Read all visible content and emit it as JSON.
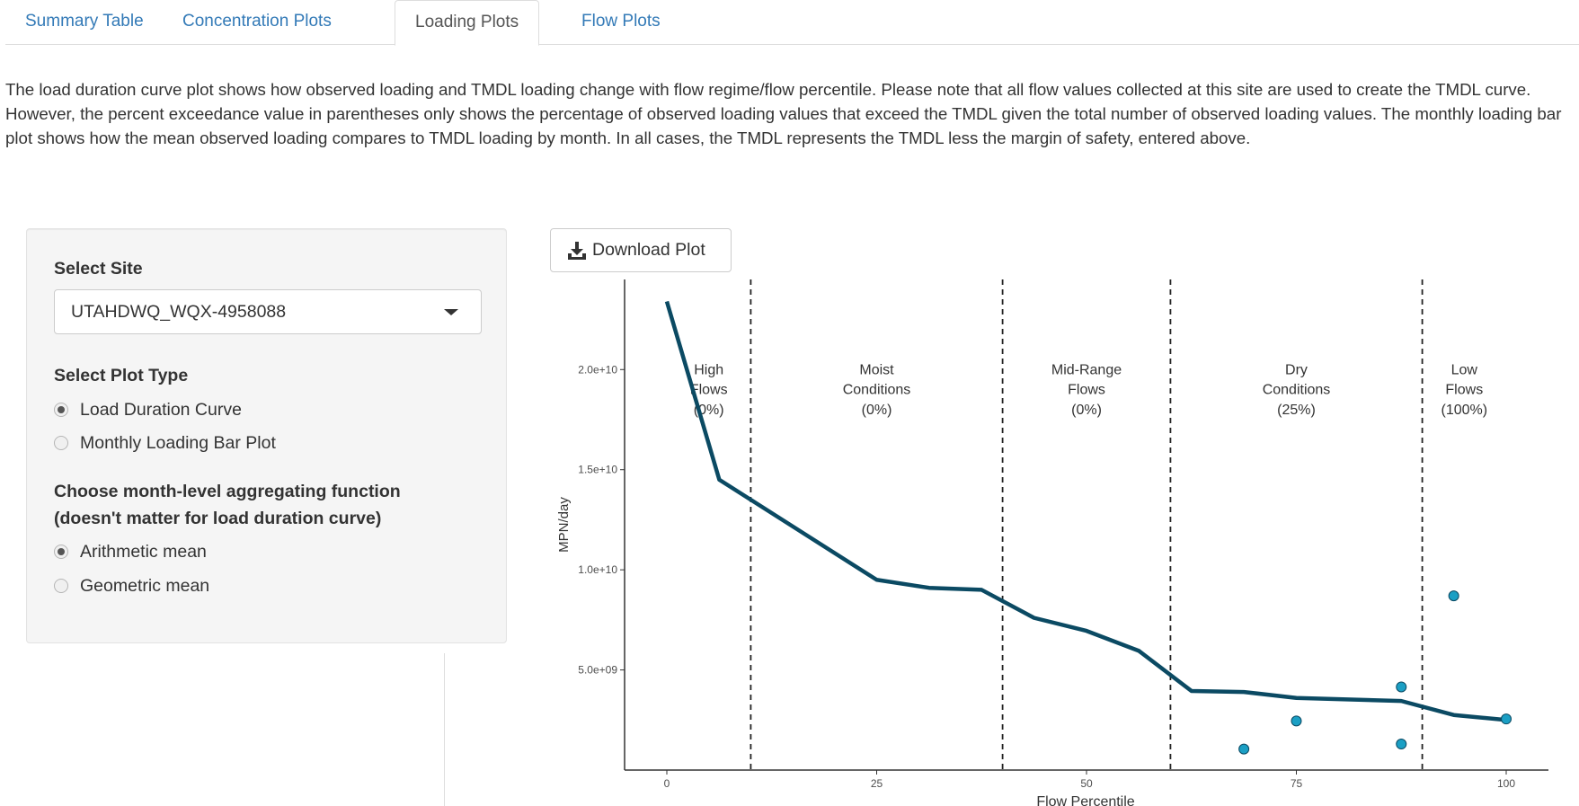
{
  "tabs": [
    {
      "label": "Summary Table",
      "active": false
    },
    {
      "label": "Concentration Plots",
      "active": false
    },
    {
      "label": "Loading Plots",
      "active": true
    },
    {
      "label": "Flow Plots",
      "active": false
    }
  ],
  "description": "The load duration curve plot shows how observed loading and TMDL loading change with flow regime/flow percentile. Please note that all flow values collected at this site are used to create the TMDL curve. However, the percent exceedance value in parentheses only shows the percentage of observed loading values that exceed the TMDL given the total number of observed loading values. The monthly loading bar plot shows how the mean observed loading compares to TMDL loading by month. In all cases, the TMDL represents the TMDL less the margin of safety, entered above.",
  "sidebar": {
    "site_label": "Select Site",
    "site_value": "UTAHDWQ_WQX-4958088",
    "plot_type_label": "Select Plot Type",
    "plot_types": [
      {
        "label": "Load Duration Curve",
        "checked": true
      },
      {
        "label": "Monthly Loading Bar Plot",
        "checked": false
      }
    ],
    "agg_label_line1": "Choose month-level aggregating function",
    "agg_label_line2": "(doesn't matter for load duration curve)",
    "agg_options": [
      {
        "label": "Arithmetic mean",
        "checked": true
      },
      {
        "label": "Geometric mean",
        "checked": false
      }
    ]
  },
  "download_button": {
    "label": "Download Plot",
    "icon": "download-icon"
  },
  "colors": {
    "link": "#337ab7",
    "curve": "#0b4a63",
    "points": "#1b9fc4"
  },
  "chart_data": {
    "type": "line",
    "xlabel": "Flow Percentile",
    "ylabel": "MPN/day",
    "xlim": [
      0,
      100
    ],
    "ylim": [
      0,
      24500000000.0
    ],
    "x_ticks": [
      {
        "value": 0,
        "label": "0"
      },
      {
        "value": 25,
        "label": "25"
      },
      {
        "value": 50,
        "label": "50"
      },
      {
        "value": 75,
        "label": "75"
      },
      {
        "value": 100,
        "label": "100"
      }
    ],
    "y_ticks": [
      {
        "value": 5000000000.0,
        "label": "5.0e+09"
      },
      {
        "value": 10000000000.0,
        "label": "1.0e+10"
      },
      {
        "value": 15000000000.0,
        "label": "1.5e+10"
      },
      {
        "value": 20000000000.0,
        "label": "2.0e+10"
      }
    ],
    "grid": false,
    "series": [
      {
        "kind": "line",
        "x": [
          0,
          6.25,
          25,
          31.25,
          37.5,
          43.75,
          50,
          56.25,
          62.5,
          68.75,
          75,
          87.5,
          93.75,
          100
        ],
        "y": [
          23400000000.0,
          14500000000.0,
          9500000000.0,
          9100000000.0,
          9000000000.0,
          7600000000.0,
          6950000000.0,
          5950000000.0,
          3950000000.0,
          3900000000.0,
          3600000000.0,
          3450000000.0,
          2750000000.0,
          2500000000.0
        ]
      },
      {
        "kind": "scatter",
        "x": [
          68.75,
          75,
          87.5,
          87.5,
          93.75,
          100
        ],
        "y": [
          1050000000.0,
          2450000000.0,
          1300000000.0,
          4150000000.0,
          8700000000.0,
          2550000000.0
        ]
      }
    ],
    "dividers": [
      10,
      40,
      60,
      90
    ],
    "regions": [
      {
        "lines": [
          "High",
          "Flows",
          "(0%)"
        ],
        "x": 5
      },
      {
        "lines": [
          "Moist",
          "Conditions",
          "(0%)"
        ],
        "x": 25
      },
      {
        "lines": [
          "Mid-Range",
          "Flows",
          "(0%)"
        ],
        "x": 50
      },
      {
        "lines": [
          "Dry",
          "Conditions",
          "(25%)"
        ],
        "x": 75
      },
      {
        "lines": [
          "Low",
          "Flows",
          "(100%)"
        ],
        "x": 95
      }
    ],
    "region_label_y": [
      20000000000.0,
      19000000000.0,
      18000000000.0
    ]
  }
}
